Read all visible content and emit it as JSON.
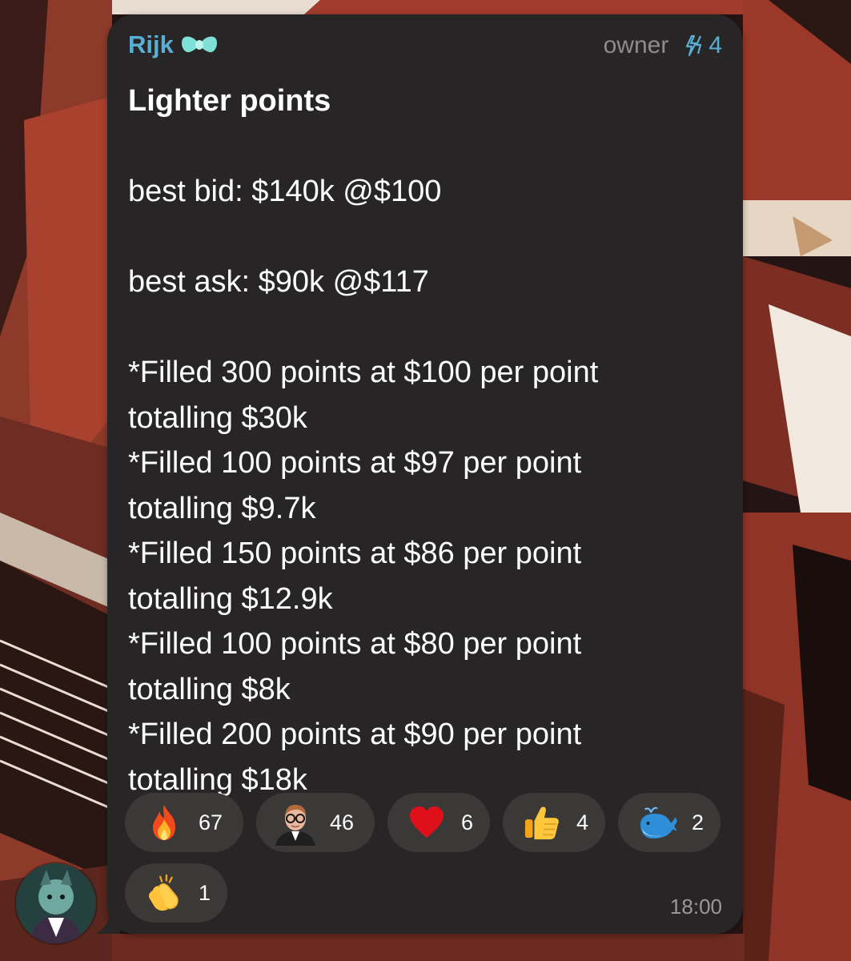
{
  "message": {
    "sender": "Rijk",
    "sender_color": "#5aaed4",
    "sender_badge_icon": "bow-emoji-icon",
    "role": "owner",
    "boost_icon": "boost-lightning-icon",
    "boost_count": "4",
    "title": "Lighter points",
    "lines": {
      "best_bid": "best bid: $140k @$100",
      "best_ask": "best ask: $90k @$117",
      "fill_1a": "*Filled 300 points at $100 per point",
      "fill_1b": "totalling $30k",
      "fill_2a": "*Filled 100 points at $97 per point",
      "fill_2b": "totalling $9.7k",
      "fill_3a": "*Filled 150 points at $86 per point",
      "fill_3b": "totalling $12.9k",
      "fill_4a": "*Filled 100 points at $80 per point",
      "fill_4b": "totalling $8k",
      "fill_5a": "*Filled 200 points at $90 per point",
      "fill_5b": "totalling $18k"
    },
    "time": "18:00",
    "bubble_color": "#272525"
  },
  "reactions": [
    {
      "icon": "fire-emoji-icon",
      "count": "67"
    },
    {
      "icon": "custom-avatar-emoji-icon",
      "count": "46"
    },
    {
      "icon": "red-heart-emoji-icon",
      "count": "6"
    },
    {
      "icon": "thumbs-up-emoji-icon",
      "count": "4"
    },
    {
      "icon": "whale-emoji-icon",
      "count": "2"
    },
    {
      "icon": "clapping-hands-emoji-icon",
      "count": "1"
    }
  ]
}
